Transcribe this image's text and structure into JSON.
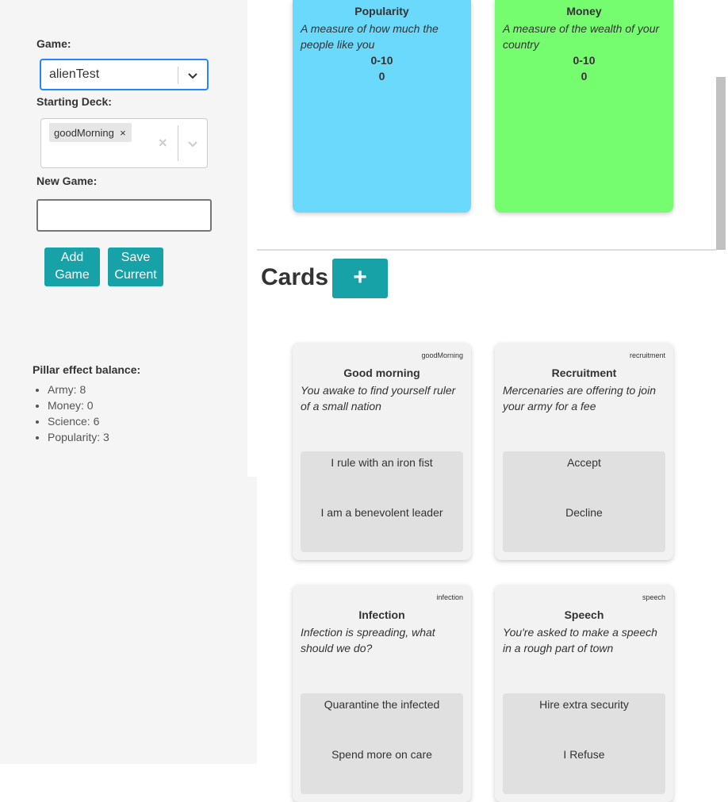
{
  "sidebar": {
    "game_label": "Game:",
    "game_value": "alienTest",
    "deck_label": "Starting Deck:",
    "deck_chip": "goodMorning",
    "new_game_label": "New Game:",
    "new_game_value": "",
    "add_game_label": "Add Game",
    "save_current_label": "Save Current",
    "balance_title": "Pillar effect balance:",
    "balance": [
      "Army: 8",
      "Money: 0",
      "Science: 6",
      "Popularity: 3"
    ]
  },
  "pillars": [
    {
      "title": "Popularity",
      "desc": "A measure of how much the people like you",
      "range": "0-10",
      "value": "0",
      "color": "#6ad9fc"
    },
    {
      "title": "Money",
      "desc": "A measure of the wealth of your country",
      "range": "0-10",
      "value": "0",
      "color": "#75fc6f"
    }
  ],
  "cards_section": {
    "title": "Cards",
    "add_label": "+"
  },
  "cards": [
    {
      "tag": "goodMorning",
      "title": "Good morning",
      "desc": "You awake to find yourself ruler of a small nation",
      "answers": [
        "I rule with an iron fist",
        "I am a benevolent leader"
      ]
    },
    {
      "tag": "recruitment",
      "title": "Recruitment",
      "desc": "Mercenaries are offering to join your army for a fee",
      "answers": [
        "Accept",
        "Decline"
      ]
    },
    {
      "tag": "infection",
      "title": "Infection",
      "desc": "Infection is spreading, what should we do?",
      "answers": [
        "Quarantine the infected",
        "Spend more on care"
      ]
    },
    {
      "tag": "speech",
      "title": "Speech",
      "desc": "You're asked to make a speech in a rough part of town",
      "answers": [
        "Hire extra security",
        "I Refuse"
      ]
    }
  ],
  "colors": {
    "accent": "#17a2a8",
    "focus": "#2684ff"
  }
}
